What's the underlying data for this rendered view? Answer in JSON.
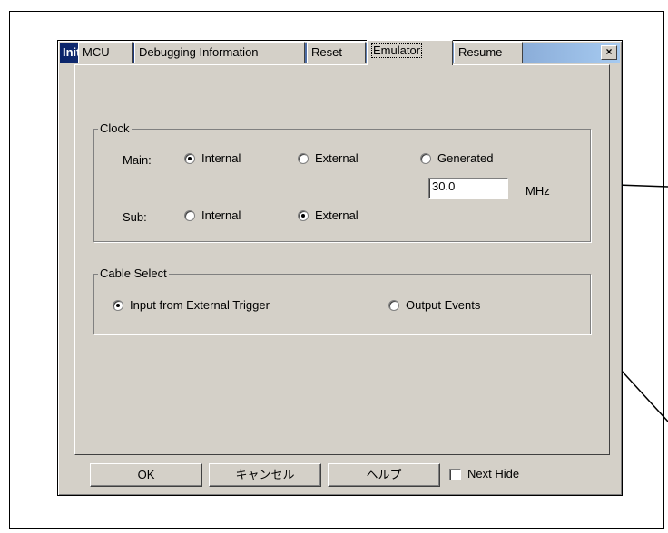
{
  "dialog": {
    "title": "Init",
    "close_glyph": "×"
  },
  "tabs": [
    {
      "label": "MCU",
      "active": false
    },
    {
      "label": "Debugging Information",
      "active": false
    },
    {
      "label": "Reset",
      "active": false
    },
    {
      "label": "Emulator",
      "active": true
    },
    {
      "label": "Resume",
      "active": false
    }
  ],
  "clock": {
    "group_label": "Clock",
    "main_label": "Main:",
    "main_options": [
      "Internal",
      "External",
      "Generated"
    ],
    "main_selected": "Internal",
    "sub_label": "Sub:",
    "sub_options": [
      "Internal",
      "External"
    ],
    "sub_selected": "External",
    "frequency_value": "30.0",
    "frequency_unit": "MHz"
  },
  "cable": {
    "group_label": "Cable Select",
    "options": [
      "Input from External Trigger",
      "Output Events"
    ],
    "selected": "Input from External Trigger"
  },
  "buttons": {
    "ok": "OK",
    "cancel": "キャンセル",
    "help": "ヘルプ",
    "next_hide": "Next Hide",
    "next_hide_checked": false
  },
  "colors": {
    "dialog_face": "#d4d0c8",
    "title_start": "#0a246a",
    "title_end": "#a6caf0"
  }
}
